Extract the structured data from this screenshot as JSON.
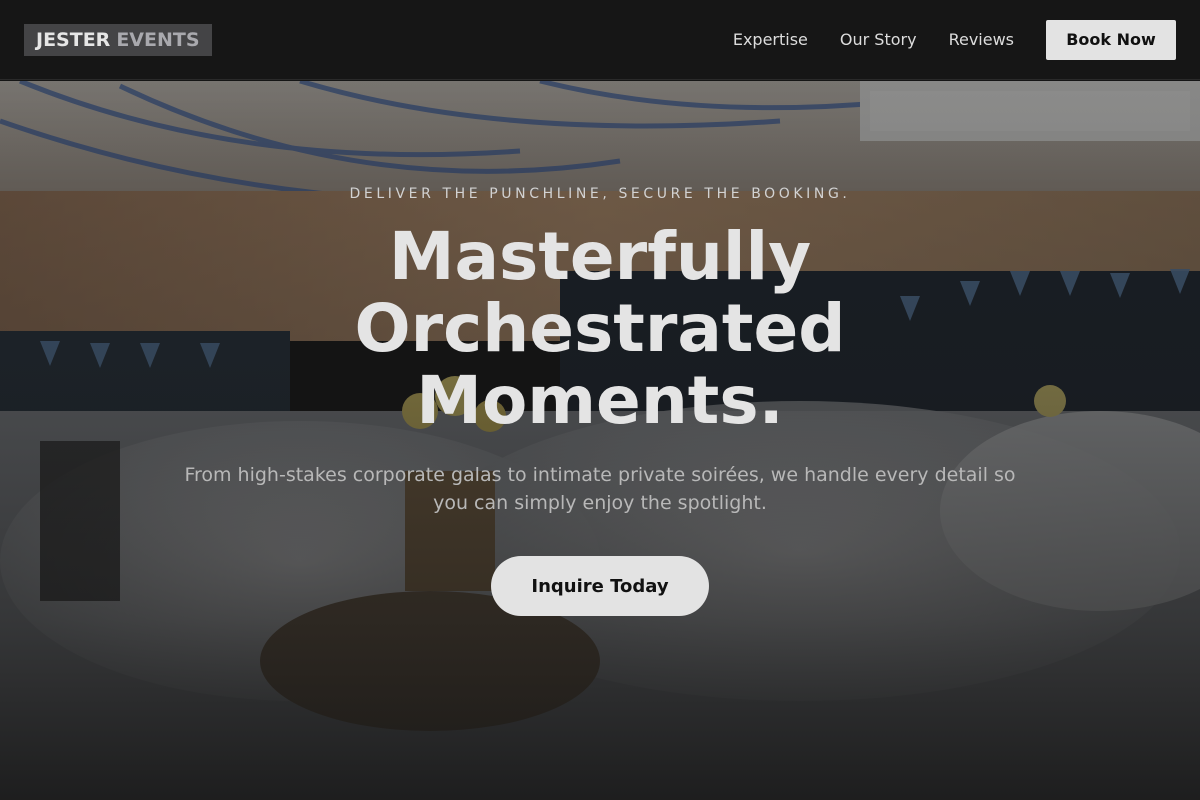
{
  "brand": {
    "word1": "JESTER",
    "word2": "EVENTS"
  },
  "nav": {
    "links": [
      {
        "label": "Expertise"
      },
      {
        "label": "Our Story"
      },
      {
        "label": "Reviews"
      }
    ],
    "cta_label": "Book Now"
  },
  "hero": {
    "eyebrow": "DELIVER THE PUNCHLINE, SECURE THE BOOKING.",
    "headline_lines": [
      "Masterfully",
      "Orchestrated",
      "Moments."
    ],
    "subtext": "From high-stakes corporate galas to intimate private soirées, we handle every detail so you can simply enjoy the spotlight.",
    "cta_label": "Inquire Today"
  },
  "colors": {
    "header_bg": "#161616",
    "button_bg": "#e3e3e3",
    "text_light": "#e4e4e4"
  }
}
